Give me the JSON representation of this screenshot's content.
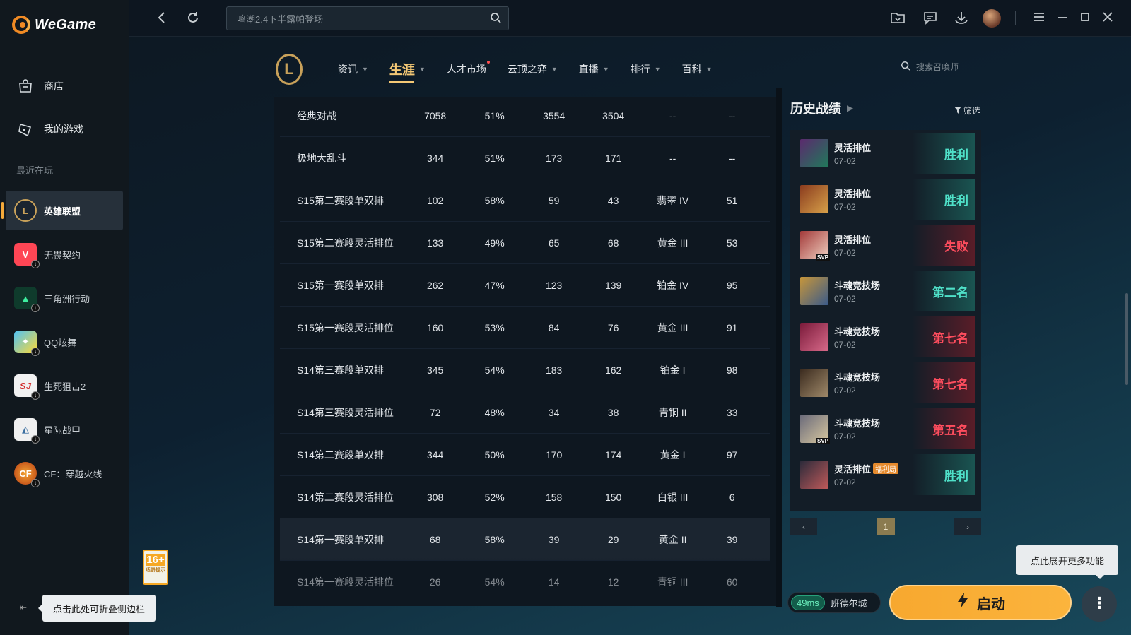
{
  "app": {
    "name": "WeGame"
  },
  "sidebar": {
    "nav": [
      {
        "label": "商店",
        "icon": "bag-icon"
      },
      {
        "label": "我的游戏",
        "icon": "gamepad-icon"
      }
    ],
    "recent_label": "最近在玩",
    "games": [
      {
        "label": "英雄联盟",
        "icon": "league-of-legends-icon",
        "active": true
      },
      {
        "label": "无畏契约",
        "icon": "valorant-icon",
        "active": false
      },
      {
        "label": "三角洲行动",
        "icon": "delta-force-icon",
        "active": false
      },
      {
        "label": "QQ炫舞",
        "icon": "qq-dance-icon",
        "active": false
      },
      {
        "label": "生死狙击2",
        "icon": "shengsi-juji-icon",
        "active": false
      },
      {
        "label": "星际战甲",
        "icon": "warframe-icon",
        "active": false
      },
      {
        "label": "CF：穿越火线",
        "icon": "crossfire-icon",
        "active": false
      }
    ],
    "age_rating": {
      "value": "16+",
      "text": "适龄提示"
    },
    "collapse_tip": "点击此处可折叠侧边栏"
  },
  "topbar": {
    "search_placeholder": "鸣潮2.4下半露帕登场",
    "icons": [
      "back-icon",
      "refresh-icon",
      "folder-icon",
      "message-icon",
      "download-icon",
      "avatar",
      "menu-icon",
      "minimize-icon",
      "maximize-icon",
      "close-icon"
    ]
  },
  "gamenav": {
    "tabs": [
      {
        "label": "资讯",
        "active": false,
        "dot": false
      },
      {
        "label": "生涯",
        "active": true,
        "dot": false
      },
      {
        "label": "人才市场",
        "active": false,
        "dot": true
      },
      {
        "label": "云顶之弈",
        "active": false,
        "dot": false
      },
      {
        "label": "直播",
        "active": false,
        "dot": false
      },
      {
        "label": "排行",
        "active": false,
        "dot": false
      },
      {
        "label": "百科",
        "active": false,
        "dot": false
      }
    ],
    "summoner_search_placeholder": "搜索召唤师"
  },
  "stats_table": {
    "rows": [
      [
        "经典对战",
        "7058",
        "51%",
        "3554",
        "3504",
        "--",
        "--"
      ],
      [
        "极地大乱斗",
        "344",
        "51%",
        "173",
        "171",
        "--",
        "--"
      ],
      [
        "S15第二赛段单双排",
        "102",
        "58%",
        "59",
        "43",
        "翡翠 IV",
        "51"
      ],
      [
        "S15第二赛段灵活排位",
        "133",
        "49%",
        "65",
        "68",
        "黄金 III",
        "53"
      ],
      [
        "S15第一赛段单双排",
        "262",
        "47%",
        "123",
        "139",
        "铂金 IV",
        "95"
      ],
      [
        "S15第一赛段灵活排位",
        "160",
        "53%",
        "84",
        "76",
        "黄金 III",
        "91"
      ],
      [
        "S14第三赛段单双排",
        "345",
        "54%",
        "183",
        "162",
        "铂金 I",
        "98"
      ],
      [
        "S14第三赛段灵活排位",
        "72",
        "48%",
        "34",
        "38",
        "青铜 II",
        "33"
      ],
      [
        "S14第二赛段单双排",
        "344",
        "50%",
        "170",
        "174",
        "黄金 I",
        "97"
      ],
      [
        "S14第二赛段灵活排位",
        "308",
        "52%",
        "158",
        "150",
        "白银 III",
        "6"
      ],
      [
        "S14第一赛段单双排",
        "68",
        "58%",
        "39",
        "29",
        "黄金 II",
        "39"
      ],
      [
        "S14第一赛段灵活排位",
        "26",
        "54%",
        "14",
        "12",
        "青铜 III",
        "60"
      ]
    ],
    "highlighted_row": 10
  },
  "history": {
    "title": "历史战绩",
    "filter_label": "筛选",
    "matches": [
      {
        "mode": "灵活排位",
        "date": "07-02",
        "result": "胜利",
        "outcome": "win",
        "svp": false,
        "tag": ""
      },
      {
        "mode": "灵活排位",
        "date": "07-02",
        "result": "胜利",
        "outcome": "win",
        "svp": false,
        "tag": ""
      },
      {
        "mode": "灵活排位",
        "date": "07-02",
        "result": "失败",
        "outcome": "lose",
        "svp": true,
        "tag": ""
      },
      {
        "mode": "斗魂竞技场",
        "date": "07-02",
        "result": "第二名",
        "outcome": "win",
        "svp": false,
        "tag": ""
      },
      {
        "mode": "斗魂竞技场",
        "date": "07-02",
        "result": "第七名",
        "outcome": "lose",
        "svp": false,
        "tag": ""
      },
      {
        "mode": "斗魂竞技场",
        "date": "07-02",
        "result": "第七名",
        "outcome": "lose",
        "svp": false,
        "tag": ""
      },
      {
        "mode": "斗魂竞技场",
        "date": "07-02",
        "result": "第五名",
        "outcome": "lose",
        "svp": true,
        "tag": ""
      },
      {
        "mode": "灵活排位",
        "date": "07-02",
        "result": "胜利",
        "outcome": "win",
        "svp": false,
        "tag": "福利局"
      }
    ],
    "current_page": "1",
    "svp_label": "SVP"
  },
  "bottom": {
    "ping": "49ms",
    "server": "班德尔城",
    "launch_label": "启动",
    "more_tip": "点此展开更多功能"
  },
  "colors": {
    "accent": "#f7a82f",
    "win": "#4fe0c8",
    "lose": "#ff4d5e",
    "active_tab": "#f4c875"
  }
}
